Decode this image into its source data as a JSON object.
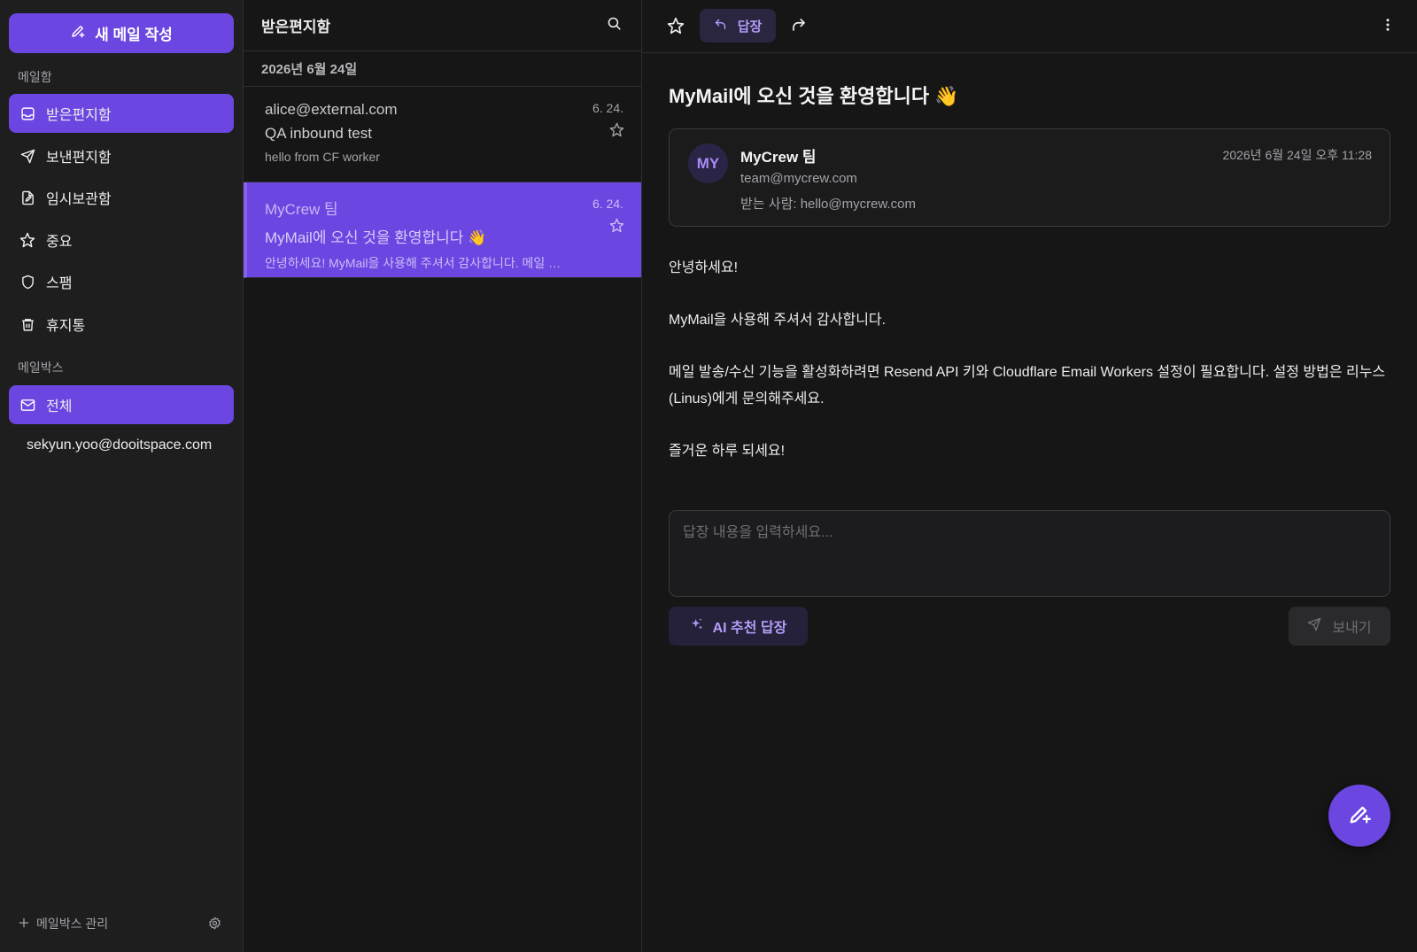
{
  "sidebar": {
    "compose_label": "새 메일 작성",
    "mailbox_section": "메일함",
    "items": [
      {
        "label": "받은편지함",
        "icon": "inbox-icon"
      },
      {
        "label": "보낸편지함",
        "icon": "send-icon"
      },
      {
        "label": "임시보관함",
        "icon": "draft-icon"
      },
      {
        "label": "중요",
        "icon": "star-icon"
      },
      {
        "label": "스팸",
        "icon": "shield-icon"
      },
      {
        "label": "휴지통",
        "icon": "trash-icon"
      }
    ],
    "mailbox_group_section": "메일박스",
    "all_label": "전체",
    "account": "sekyun.yoo@dooitspace.com",
    "manage_label": "메일박스 관리"
  },
  "list": {
    "title": "받은편지함",
    "date_group": "2026년 6월 24일",
    "mails": [
      {
        "from": "alice@external.com",
        "subject": "QA inbound test",
        "preview": "hello from CF worker",
        "date": "6. 24."
      },
      {
        "from": "MyCrew 팀",
        "subject": "MyMail에 오신 것을 환영합니다 👋",
        "preview": "안녕하세요! MyMail을 사용해 주셔서 감사합니다. 메일 발송/수신 기능을 활성화하려면",
        "date": "6. 24."
      }
    ]
  },
  "reader": {
    "reply_label": "답장",
    "subject": "MyMail에 오신 것을 환영합니다 👋",
    "sender": {
      "avatar": "MY",
      "name": "MyCrew 팀",
      "email": "team@mycrew.com",
      "to": "받는 사람: hello@mycrew.com",
      "time": "2026년 6월 24일 오후 11:28"
    },
    "body": {
      "p1": "안녕하세요!",
      "p2": "MyMail을 사용해 주셔서 감사합니다.",
      "p3": "메일 발송/수신 기능을 활성화하려면 Resend API 키와 Cloudflare Email Workers 설정이 필요합니다. 설정 방법은 리누스(Linus)에게 문의해주세요.",
      "p4": "즐거운 하루 되세요!"
    },
    "reply_placeholder": "답장 내용을 입력하세요...",
    "ai_label": "AI 추천 답장",
    "send_label": "보내기"
  },
  "colors": {
    "accent": "#6b46e0",
    "background": "#161616",
    "sidebar": "#1e1e1f"
  }
}
